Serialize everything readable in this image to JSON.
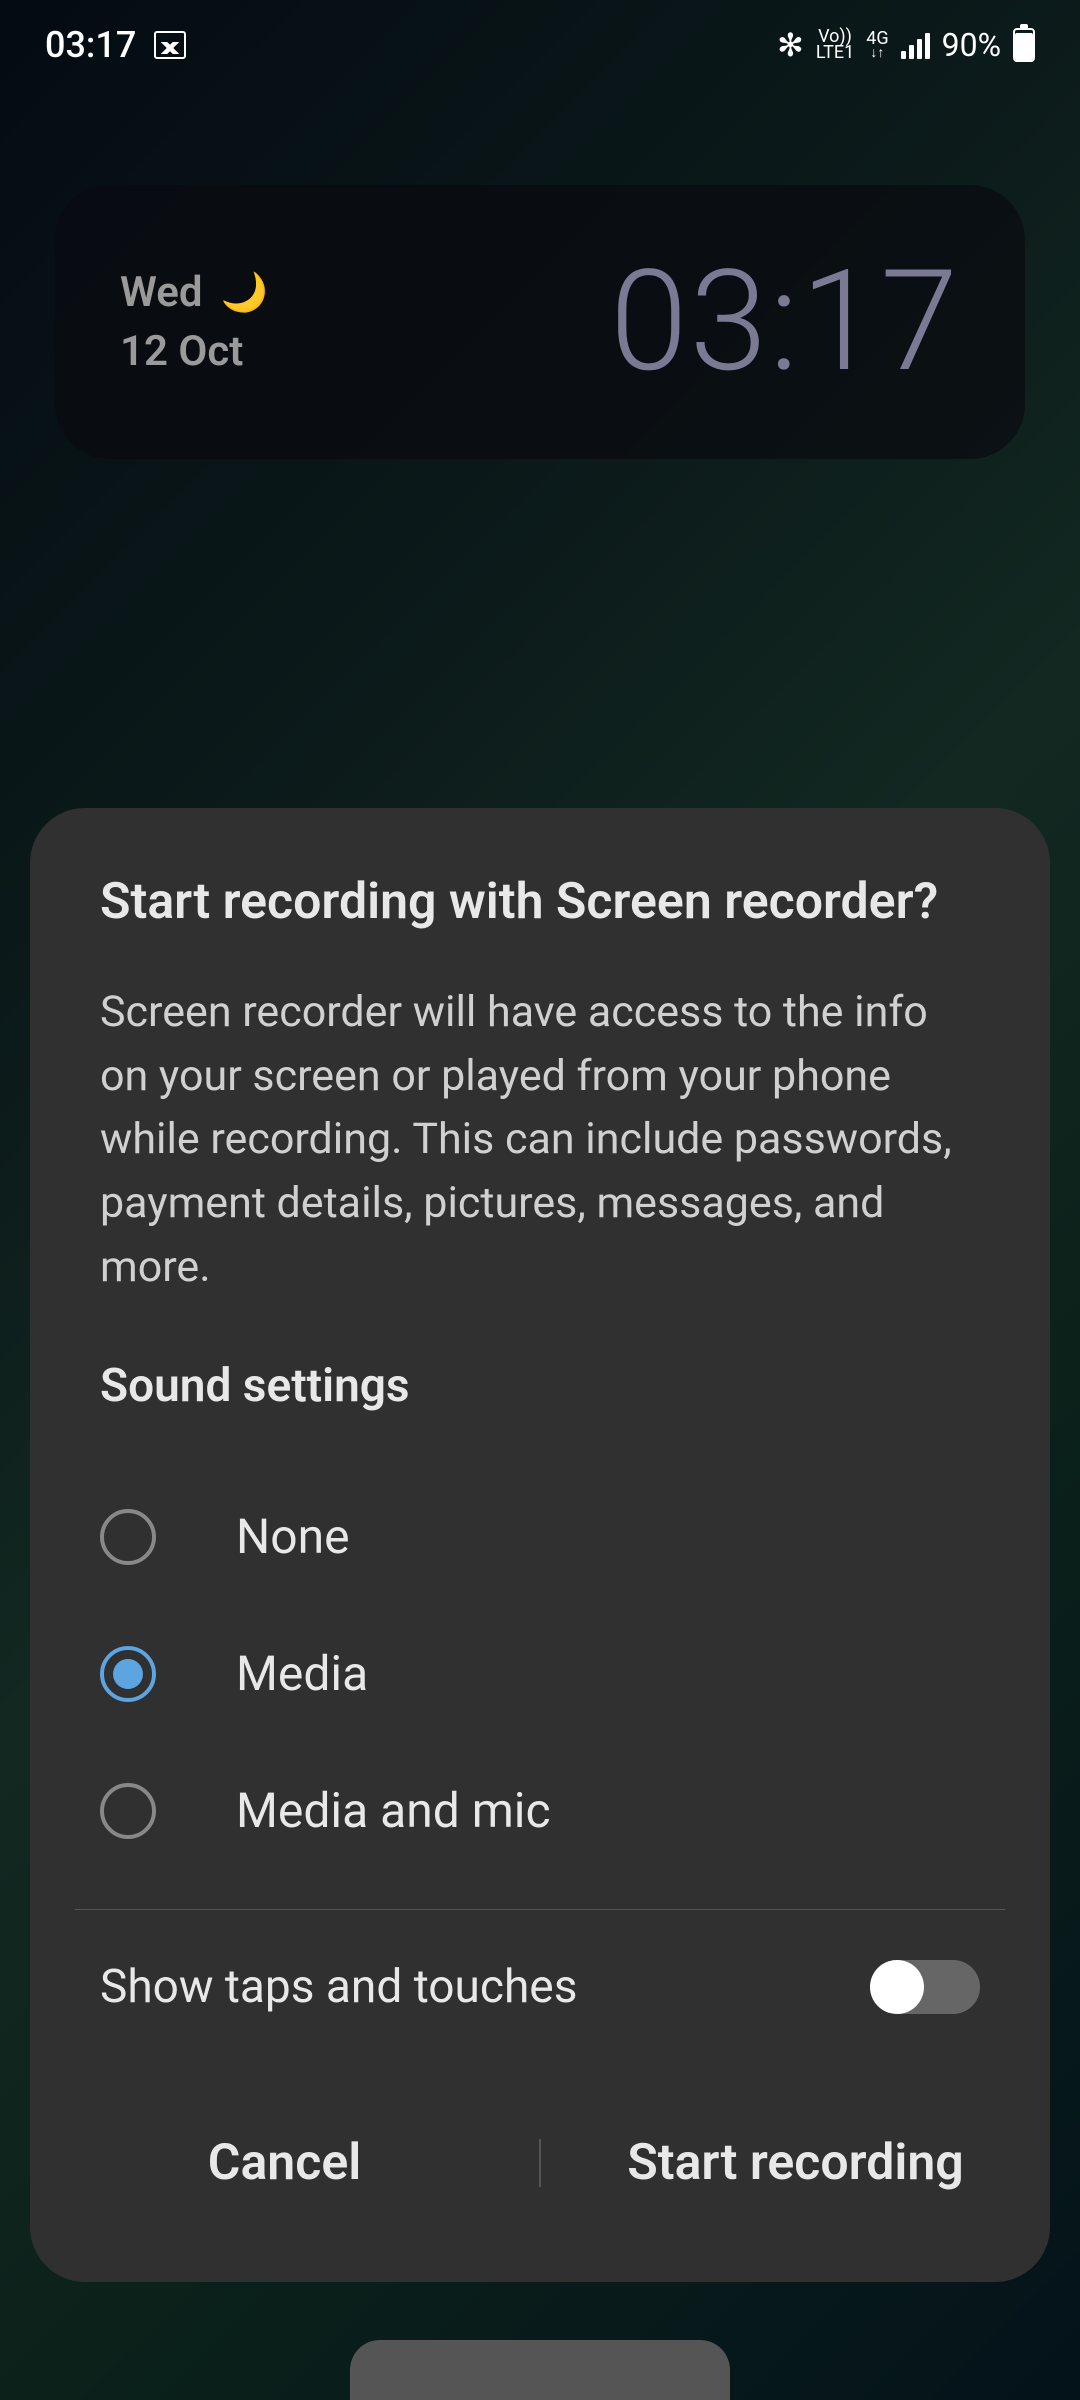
{
  "status": {
    "time": "03:17",
    "battery_percent": "90%",
    "network": "4G",
    "volte": "Vo))",
    "lte": "LTE1"
  },
  "widget": {
    "day": "Wed",
    "date": "12 Oct",
    "clock": "03:17"
  },
  "dialog": {
    "title": "Start recording with Screen recorder?",
    "body": "Screen recorder will have access to the info on your screen or played from your phone while recording. This can include passwords, payment details, pictures, messages, and more.",
    "sound_section": "Sound settings",
    "options": [
      {
        "label": "None"
      },
      {
        "label": "Media"
      },
      {
        "label": "Media and mic"
      }
    ],
    "selected_index": 1,
    "toggle_label": "Show taps and touches",
    "cancel": "Cancel",
    "confirm": "Start recording"
  }
}
